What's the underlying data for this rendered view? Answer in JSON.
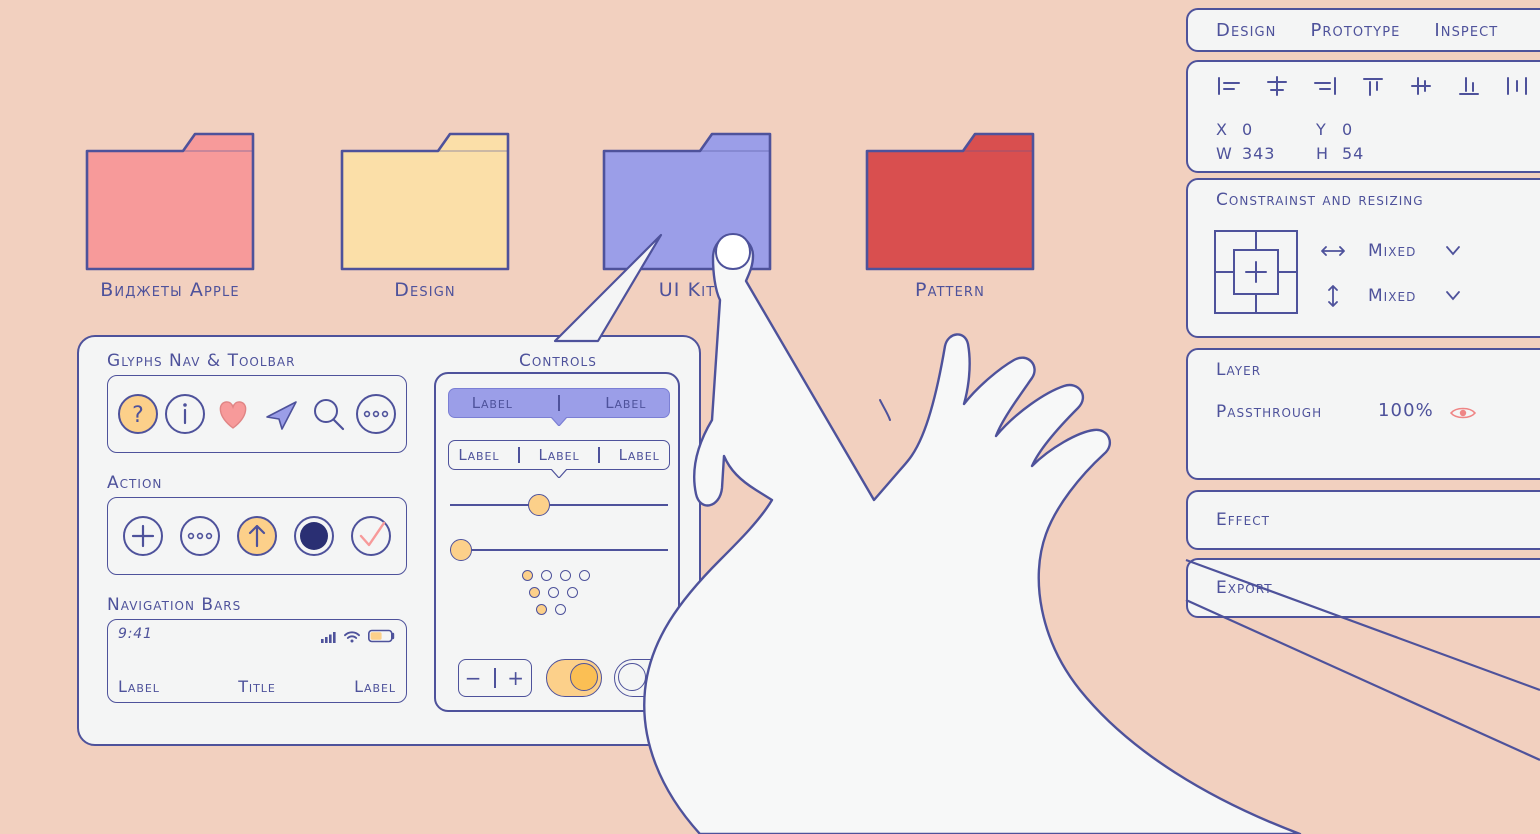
{
  "colors": {
    "background": "#f2d0bf",
    "ink": "#4e529b",
    "panel": "#f4f5f5",
    "accent_yellow": "#fcd08a",
    "accent_blue": "#9b9ee8",
    "accent_pink": "#f79a9a",
    "accent_red": "#d94f4f",
    "folder_pink": "#f79a9a",
    "folder_yellow": "#fbdfa8",
    "folder_blue": "#9b9ee8",
    "folder_red": "#d94f4f",
    "hand": "#f7f8f8"
  },
  "folders": [
    {
      "label": "Виджеты Apple",
      "color": "#f79a9a",
      "name": "folder-vidzhety-apple"
    },
    {
      "label": "Design",
      "color": "#fbdfa8",
      "name": "folder-design"
    },
    {
      "label": "UI Kit",
      "color": "#9b9ee8",
      "name": "folder-ui-kit"
    },
    {
      "label": "Pattern",
      "color": "#d94f4f",
      "name": "folder-pattern"
    }
  ],
  "inspector": {
    "tabs": [
      {
        "label": "Design",
        "active": true
      },
      {
        "label": "Prototype",
        "active": false
      },
      {
        "label": "Inspect",
        "active": false
      }
    ],
    "align_icons": [
      "align-left-icon",
      "align-horizontal-center-icon",
      "align-right-icon",
      "align-top-icon",
      "align-vertical-center-icon",
      "align-bottom-icon",
      "distribute-horizontal-icon"
    ],
    "dimensions": {
      "x_key": "X",
      "x_value": "0",
      "y_key": "Y",
      "y_value": "0",
      "w_key": "W",
      "w_value": "343",
      "h_key": "H",
      "h_value": "54"
    },
    "constraints": {
      "title": "Constrainst and resizing",
      "horizontal_value": "Mixed",
      "vertical_value": "Mixed"
    },
    "layer": {
      "title": "Layer",
      "blend_mode": "Passthrough",
      "opacity": "100%",
      "visible_icon": "eye-icon"
    },
    "effect": {
      "title": "Effect",
      "add_label": "+"
    },
    "export": {
      "title": "Export",
      "add_label": "+"
    }
  },
  "ui_card": {
    "sections": [
      {
        "title": "Glyphs Nav & Toolbar"
      },
      {
        "title": "Action"
      },
      {
        "title": "Navigation Bars"
      }
    ],
    "glyph_icons": [
      {
        "name": "help-question-icon",
        "glyph": "?"
      },
      {
        "name": "info-icon",
        "glyph": "i"
      },
      {
        "name": "heart-icon",
        "glyph": "heart"
      },
      {
        "name": "send-paperplane-icon",
        "glyph": "arrow"
      },
      {
        "name": "search-icon",
        "glyph": "magnifier"
      },
      {
        "name": "more-horizontal-icon",
        "glyph": "ellipsis"
      }
    ],
    "action_icons": [
      {
        "name": "add-plus-icon",
        "glyph": "plus"
      },
      {
        "name": "more-horizontal-icon",
        "glyph": "ellipsis"
      },
      {
        "name": "share-up-arrow-icon",
        "glyph": "up-arrow"
      },
      {
        "name": "record-filled-icon",
        "glyph": "filled-circle"
      },
      {
        "name": "checkmark-icon",
        "glyph": "check"
      }
    ],
    "navbar": {
      "time": "9:41",
      "status_icons": [
        "cellular-signal-icon",
        "wifi-icon",
        "battery-icon"
      ],
      "left_label": "Label",
      "title": "Title",
      "right_label": "Label"
    },
    "controls": {
      "title": "Controls",
      "segmented_filled": [
        "Label",
        "Label"
      ],
      "segmented_outline": [
        "Label",
        "Label",
        "Label"
      ],
      "sliders": [
        {
          "name": "slider-top",
          "value_pct": 36
        },
        {
          "name": "slider-bottom",
          "value_pct": 4
        }
      ],
      "page_dots": [
        [
          true,
          false,
          false,
          false
        ],
        [
          true,
          false,
          false,
          false
        ],
        [
          true,
          false
        ]
      ],
      "stepper": {
        "minus": "−",
        "plus": "+"
      },
      "toggles": [
        {
          "name": "toggle-on",
          "state": "on"
        },
        {
          "name": "toggle-off",
          "state": "off"
        }
      ]
    }
  }
}
